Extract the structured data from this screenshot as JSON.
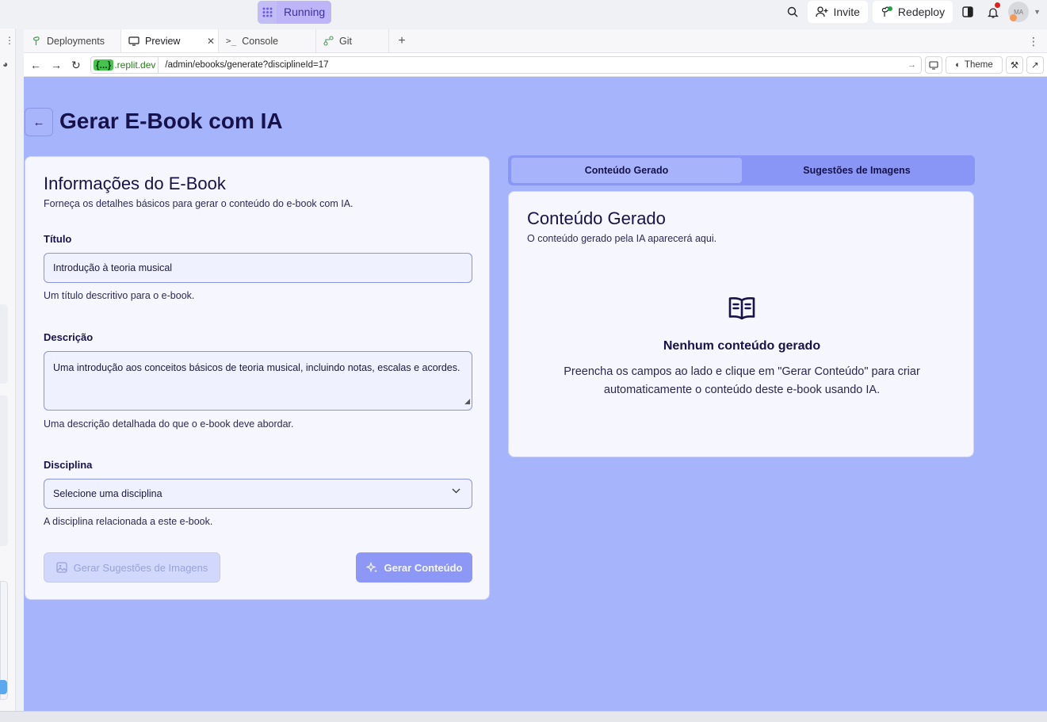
{
  "topbar": {
    "run_status": "Running",
    "invite_label": "Invite",
    "redeploy_label": "Redeploy",
    "avatar_initials": "MA"
  },
  "tabs": [
    {
      "label": "Deployments",
      "icon": "deployments-icon"
    },
    {
      "label": "Preview",
      "icon": "preview-icon",
      "active": true
    },
    {
      "label": "Console",
      "icon": "console-icon"
    },
    {
      "label": "Git",
      "icon": "git-icon"
    }
  ],
  "urlbar": {
    "domain_code": "{...}",
    "domain": ".replit.dev",
    "path": "/admin/ebooks/generate?disciplineId=17",
    "theme_label": "Theme"
  },
  "page": {
    "title": "Gerar E-Book com IA"
  },
  "form": {
    "heading": "Informações do E-Book",
    "subheading": "Forneça os detalhes básicos para gerar o conteúdo do e-book com IA.",
    "title_label": "Título",
    "title_value": "Introdução à teoria musical",
    "title_help": "Um título descritivo para o e-book.",
    "description_label": "Descrição",
    "description_value": "Uma introdução aos conceitos básicos de teoria musical, incluindo notas, escalas e acordes.",
    "description_help": "Uma descrição detalhada do que o e-book deve abordar.",
    "discipline_label": "Disciplina",
    "discipline_placeholder": "Selecione uma disciplina",
    "discipline_help": "A disciplina relacionada a este e-book.",
    "image_button": "Gerar Sugestões de Imagens",
    "generate_button": "Gerar Conteúdo"
  },
  "output": {
    "tab_content": "Conteúdo Gerado",
    "tab_images": "Sugestões de Imagens",
    "heading": "Conteúdo Gerado",
    "subheading": "O conteúdo gerado pela IA aparecerá aqui.",
    "empty_title": "Nenhum conteúdo gerado",
    "empty_text": "Preencha os campos ao lado e clique em \"Gerar Conteúdo\" para criar automaticamente o conteúdo deste e-book usando IA."
  },
  "colors": {
    "app_background": "#a6b4fb",
    "card_background": "#f6f7fe",
    "primary_button": "#8d97f6",
    "heading_text": "#17124a"
  }
}
